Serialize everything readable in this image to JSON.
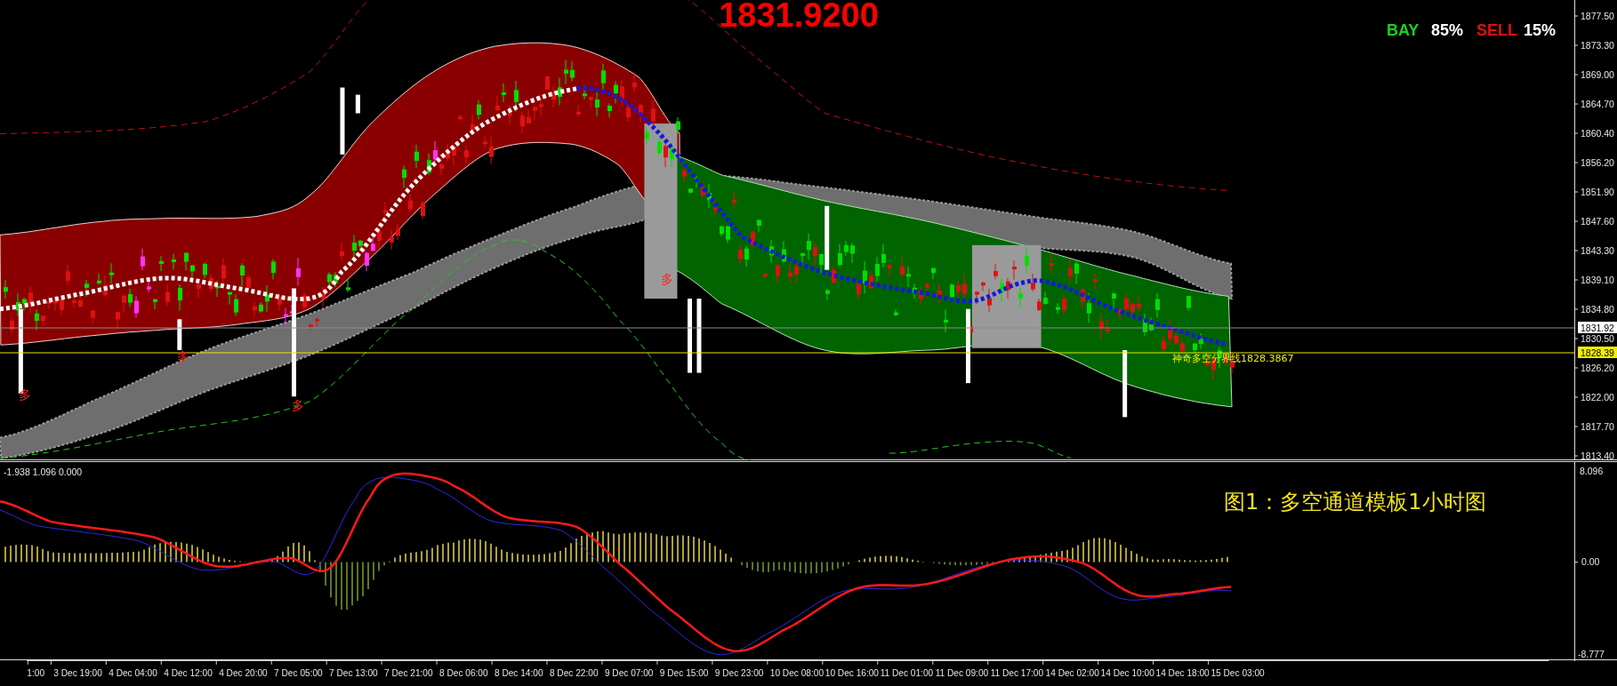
{
  "header": {
    "price": "1831.9200"
  },
  "signal": {
    "items": [
      {
        "label": "BAY",
        "value": "85%",
        "color": "#19d219"
      },
      {
        "label": "SELL",
        "value": "15%",
        "color": "#e01010"
      }
    ]
  },
  "main_chart": {
    "markers": [
      "多",
      "多",
      "多",
      "多"
    ],
    "divider_label": "神奇多空分界线1828.3867",
    "price_axis": {
      "ticks": [
        "1877.50",
        "1873.30",
        "1869.00",
        "1864.70",
        "1860.40",
        "1856.20",
        "1851.90",
        "1847.60",
        "1843.30",
        "1839.10",
        "1834.80",
        "1830.50",
        "1826.20",
        "1822.00",
        "1817.70",
        "1813.40"
      ],
      "current_price_tag": "1831.92",
      "divider_tag": "1828.39"
    }
  },
  "indicator": {
    "values": "-1.938 1.096 0.000",
    "caption": "图1：多空通道模板1小时图",
    "axis": {
      "max": "8.096",
      "zero": "0.00",
      "min": "-8.777"
    }
  },
  "time_axis": {
    "labels": [
      "1:00",
      "3 Dec 19:00",
      "4 Dec 04:00",
      "4 Dec 12:00",
      "4 Dec 20:00",
      "7 Dec 05:00",
      "7 Dec 13:00",
      "7 Dec 21:00",
      "8 Dec 06:00",
      "8 Dec 14:00",
      "8 Dec 22:00",
      "9 Dec 07:00",
      "9 Dec 15:00",
      "9 Dec 23:00",
      "10 Dec 08:00",
      "10 Dec 16:00",
      "11 Dec 01:00",
      "11 Dec 09:00",
      "11 Dec 17:00",
      "14 Dec 02:00",
      "14 Dec 10:00",
      "14 Dec 18:00",
      "15 Dec 03:00"
    ]
  }
}
